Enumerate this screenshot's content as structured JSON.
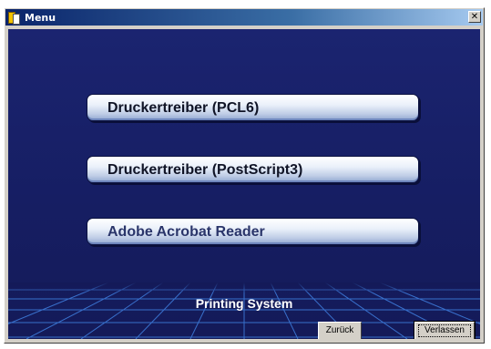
{
  "window": {
    "title": "Menu",
    "title_icon": "book-icon",
    "close_icon": "close-icon",
    "close_glyph": "✕"
  },
  "menu": {
    "items": [
      {
        "label": "Druckertreiber (PCL6)"
      },
      {
        "label": "Druckertreiber (PostScript3)"
      },
      {
        "label": "Adobe Acrobat Reader"
      }
    ]
  },
  "footer": {
    "product_name": "Printing System",
    "back_label": "Zurück",
    "exit_label": "Verlassen"
  },
  "colors": {
    "background": "#161e63",
    "grid": "#3f7fe0",
    "button_face": "#d4d0c8",
    "titlebar": "#0a246a"
  }
}
